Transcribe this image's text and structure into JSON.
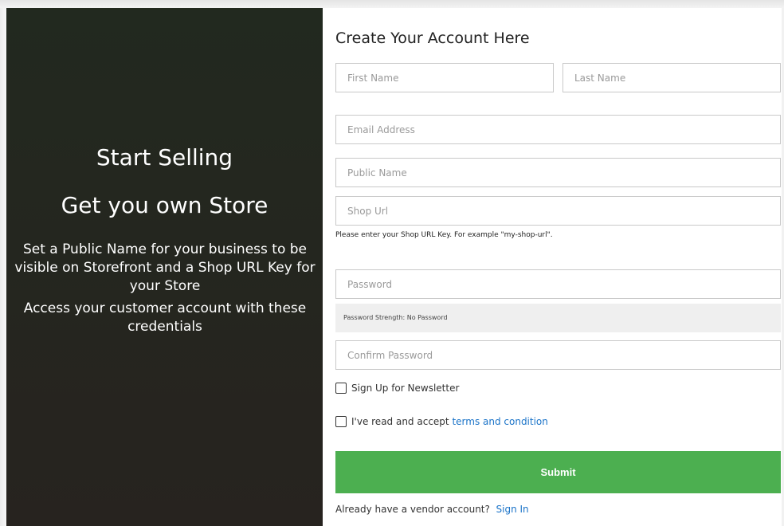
{
  "promo": {
    "title": "Start Selling",
    "subtitle": "Get you own Store",
    "paragraph1": "Set a Public Name for your business to be visible on Storefront and a Shop URL Key for your Store",
    "paragraph2": "Access your customer account with these credentials",
    "background_color": "#232520"
  },
  "form": {
    "title": "Create Your Account Here",
    "first_name": {
      "placeholder": "First Name",
      "value": ""
    },
    "last_name": {
      "placeholder": "Last Name",
      "value": ""
    },
    "email": {
      "placeholder": "Email Address",
      "value": ""
    },
    "public_name": {
      "placeholder": "Public Name",
      "value": ""
    },
    "shop_url": {
      "placeholder": "Shop Url",
      "value": ""
    },
    "shop_url_hint": "Please enter your Shop URL Key. For example \"my-shop-url\".",
    "password": {
      "placeholder": "Password",
      "value": ""
    },
    "password_strength": "Password Strength: No Password",
    "confirm_password": {
      "placeholder": "Confirm Password",
      "value": ""
    },
    "newsletter_label": "Sign Up for Newsletter",
    "terms_prefix": "I've read and accept ",
    "terms_link": "terms and condition",
    "submit_label": "Submit",
    "signin_prefix": "Already have a vendor account? ",
    "signin_link": "Sign In",
    "accent_color": "#4caf50",
    "link_color": "#1a73c8"
  }
}
